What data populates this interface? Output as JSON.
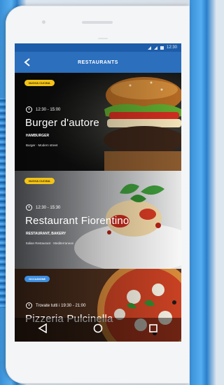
{
  "appbar": {
    "title": "RESTAURANTS"
  },
  "status": {
    "time": "12:30"
  },
  "restaurants": [
    {
      "badge": "NUOVA CUCINA",
      "badge_color": "#f2c318",
      "hours": "12:30 - 15:00",
      "name": "Burger d'autore",
      "category": "HAMBURGER",
      "desc": "Burger · Modern street"
    },
    {
      "badge": "NUOVA CUCINA",
      "badge_color": "#f2c318",
      "hours": "12:30 - 15:30",
      "name": "Restaurant Fiorentino",
      "category": "RESTAURANT, BAKERY",
      "desc": "Italian Restaurant · Mediterranean"
    },
    {
      "badge": "OCCASIONE",
      "badge_color": "#3d8ee0",
      "hours": "Trovate tutti i 19:30 - 21:00",
      "name": "Pizzeria Pulcinella",
      "category": "",
      "desc": ""
    }
  ]
}
